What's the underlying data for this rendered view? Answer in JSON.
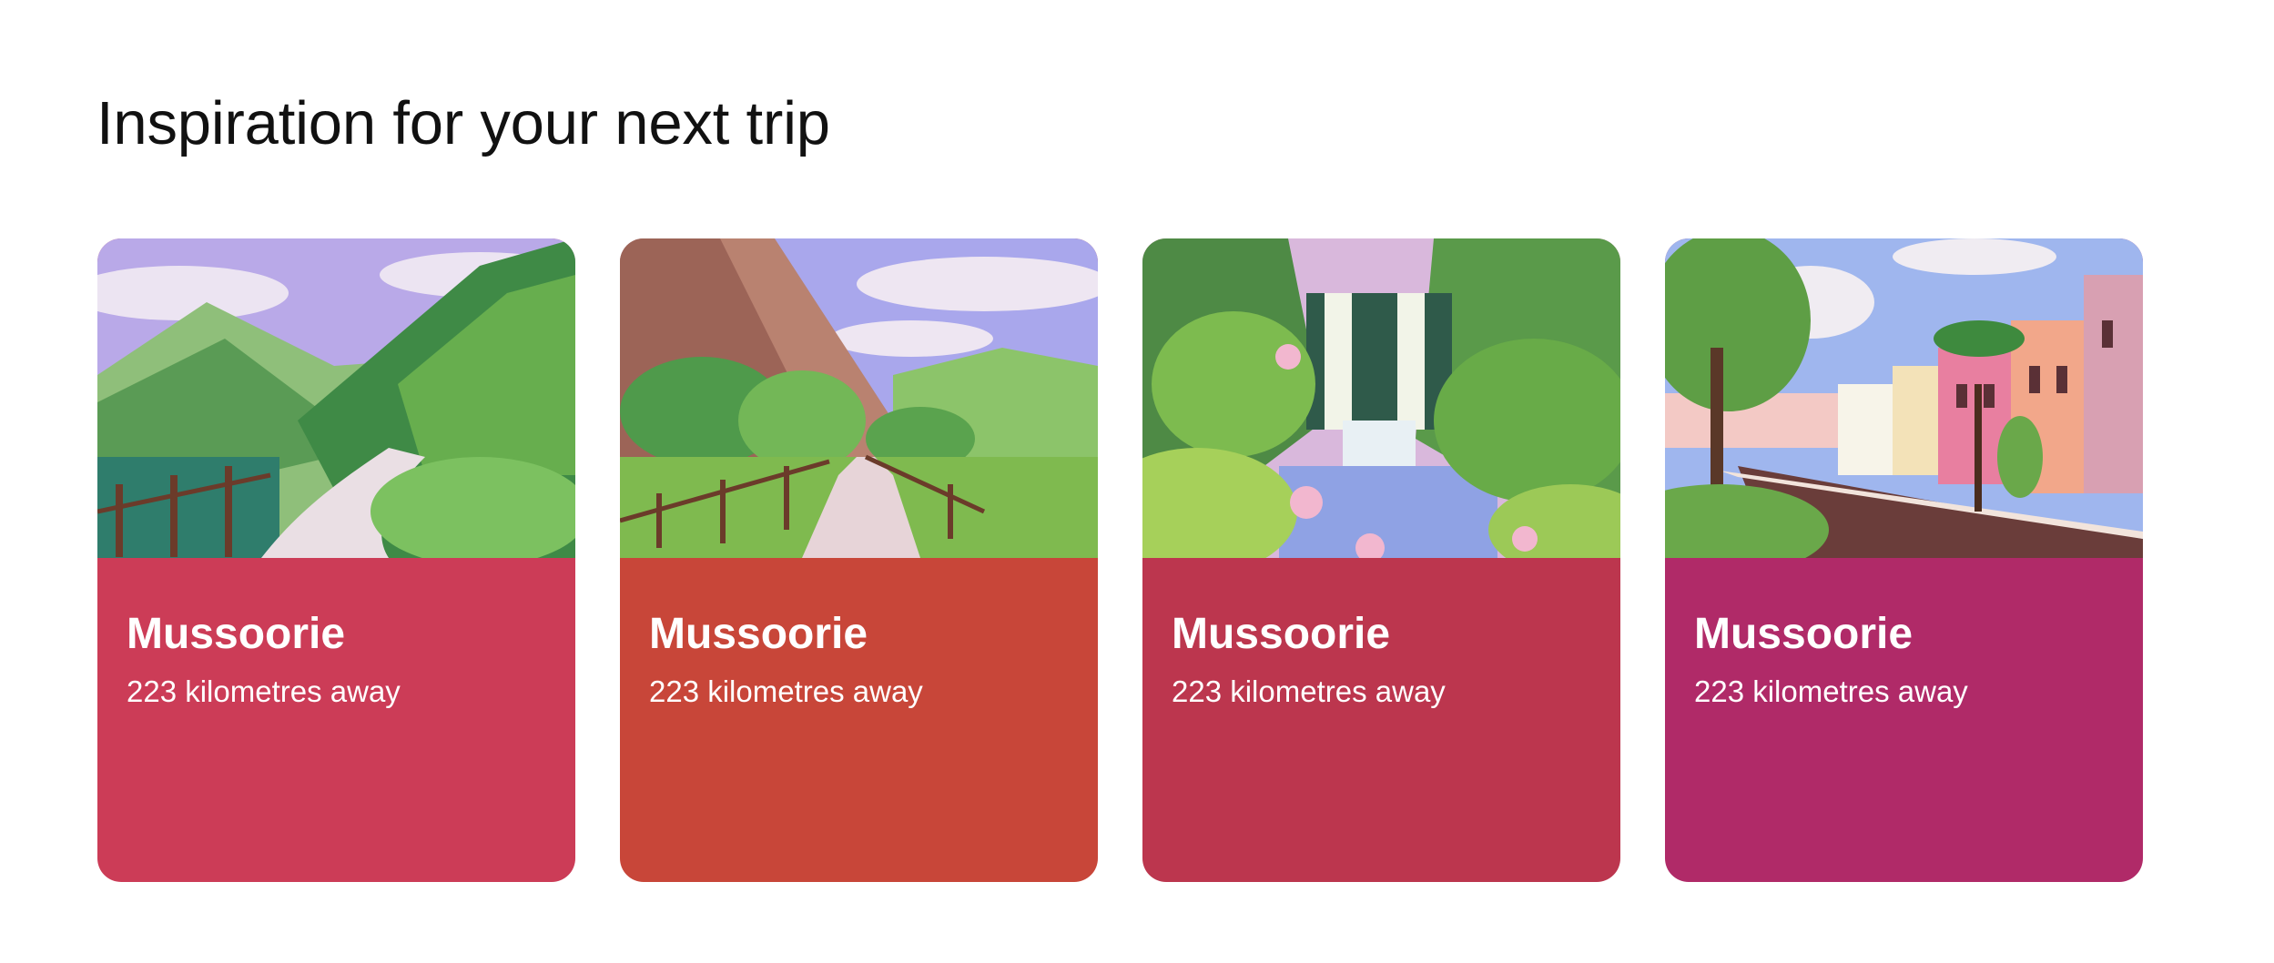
{
  "heading": "Inspiration for your next trip",
  "cards": [
    {
      "title": "Mussoorie",
      "subtitle": "223 kilometres away",
      "color": "#cc3c57",
      "scene": "valley-path-illustration"
    },
    {
      "title": "Mussoorie",
      "subtitle": "223 kilometres away",
      "color": "#c84639",
      "scene": "cliff-fence-illustration"
    },
    {
      "title": "Mussoorie",
      "subtitle": "223 kilometres away",
      "color": "#bc364e",
      "scene": "waterfall-illustration"
    },
    {
      "title": "Mussoorie",
      "subtitle": "223 kilometres away",
      "color": "#b02a68",
      "scene": "street-houses-illustration"
    }
  ]
}
